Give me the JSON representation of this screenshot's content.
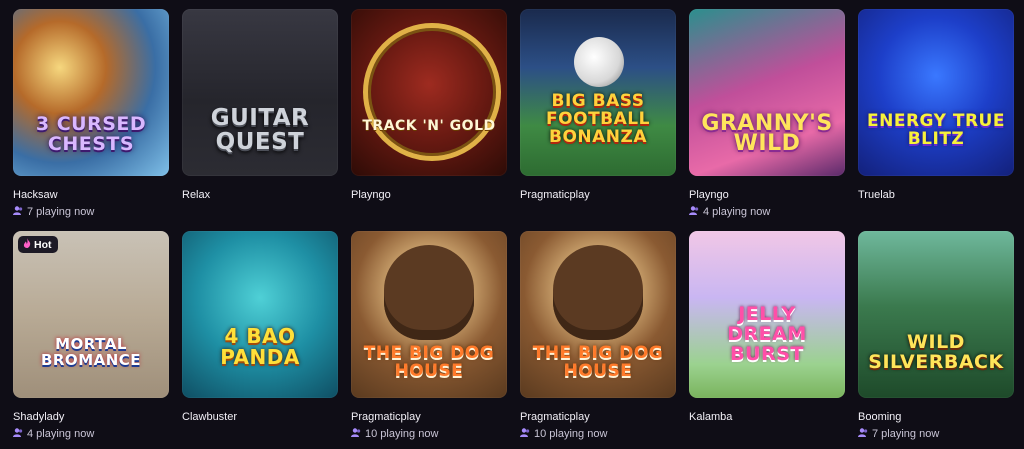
{
  "badges": {
    "hot_label": "Hot"
  },
  "games": [
    {
      "title": "3 Cursed Chests",
      "provider": "Hacksaw",
      "players": "7 playing now",
      "art": "a0",
      "hot": false
    },
    {
      "title": "Guitar Quest",
      "provider": "Relax",
      "players": "",
      "art": "a1",
      "hot": false
    },
    {
      "title": "Track 'n' Gold",
      "provider": "Playngo",
      "players": "",
      "art": "a2",
      "hot": false
    },
    {
      "title": "Big Bass Football Bonanza",
      "provider": "Pragmaticplay",
      "players": "",
      "art": "a3",
      "hot": false
    },
    {
      "title": "Granny's Wild",
      "provider": "Playngo",
      "players": "4 playing now",
      "art": "a4",
      "hot": false
    },
    {
      "title": "Energy True Blitz",
      "provider": "Truelab",
      "players": "",
      "art": "a5",
      "hot": false
    },
    {
      "title": "Mortal Bromance",
      "provider": "Shadylady",
      "players": "4 playing now",
      "art": "a6",
      "hot": true
    },
    {
      "title": "4 Bao Panda",
      "provider": "Clawbuster",
      "players": "",
      "art": "a7",
      "hot": false
    },
    {
      "title": "The Big Dog House",
      "provider": "Pragmaticplay",
      "players": "10 playing now",
      "art": "a8",
      "hot": false
    },
    {
      "title": "The Big Dog House",
      "provider": "Pragmaticplay",
      "players": "10 playing now",
      "art": "a9",
      "hot": false
    },
    {
      "title": "Jelly Dream Burst",
      "provider": "Kalamba",
      "players": "",
      "art": "a10",
      "hot": false
    },
    {
      "title": "Wild Silverback",
      "provider": "Booming",
      "players": "7 playing now",
      "art": "a11",
      "hot": false
    }
  ],
  "colors": {
    "background": "#0f0d16",
    "players_icon": "#a78bfa",
    "hot_icon": "#ff5fc8"
  }
}
